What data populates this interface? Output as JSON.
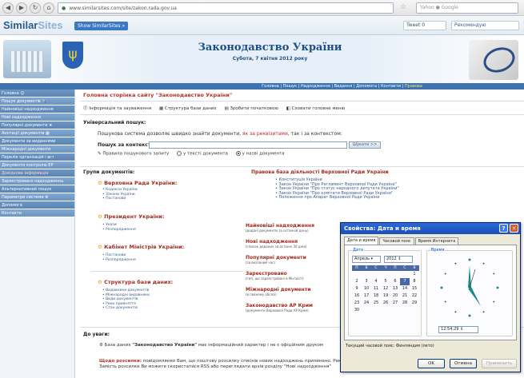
{
  "browser": {
    "url": "www.similarsites.com/site/zakon.rada.gov.ua",
    "search_placeholder": "Yahoo ● Google"
  },
  "similarsites": {
    "logo_a": "Similar",
    "logo_b": "Sites",
    "show_button": "Show SimilarSites »",
    "tweet": "Tweet",
    "tweet_count": "0",
    "fb": "Рекомендую"
  },
  "header": {
    "title": "Законодавство України",
    "subtitle": "Субота, 7 квітня 2012 року"
  },
  "topmenu": {
    "items": [
      "Головна",
      "Пошук",
      "Надходження",
      "Видання",
      "Допомога",
      "Контакти"
    ],
    "highlight": "Правова"
  },
  "sidebar": {
    "items": [
      "Головна ☺",
      "Пошук документів 🔍",
      "Найновіші надходження",
      "Нові надходження",
      "Популярні документи ★",
      "Анотації документів ▦",
      "Документи за виданнями",
      "Міжнародні документи",
      "Перелік організацій і вст",
      "Документи контролю ЕР",
      "Довідкова інформація",
      "Зареєстровано надходженнь",
      "Альтернативний пошук",
      "Параметри системи ⚙",
      "Допомога",
      "Контакти"
    ]
  },
  "main": {
    "title": "Головна сторінка сайту \"Законодавство України\"",
    "toolbar": [
      "⓵ Інформація та зауваження",
      "▦ Структура бази даних",
      "▤ Зробити початковою",
      "◧ Сховати головне меню"
    ],
    "search_heading": "Універсальний пошук:",
    "search_desc": "Пошукова система дозволяє швидко знайти документи,",
    "search_desc_link": "як за реквізитами",
    "search_desc_end": ", так і за контекстом:",
    "search_label": "Пошук за контекстом:",
    "search_btn": "Шукати >>",
    "opt_rules": "✎ Правила пошукового запиту",
    "opt1": "у тексті документа",
    "opt2": "у назві документа",
    "groups_title": "Групи документів:",
    "g1": "Верховна Рада України:",
    "g1_items": [
      "• Кодекси України",
      "• Закони України",
      "• Постанови"
    ],
    "g2": "Президент України:",
    "g2_items": [
      "• Укази",
      "• Розпорядження"
    ],
    "g3": "Кабінет Міністрів України:",
    "g3_items": [
      "• Постанови",
      "• Розпорядження"
    ],
    "g4": "Структура бази даних:",
    "g4_items": [
      "• Видавники документів",
      "• Міжнародні видавники",
      "• Види документів",
      "• Роки прийняття",
      "• Стан документів"
    ],
    "right_title": "Правова база діяльності Верховної Ради України",
    "right_items": [
      "• Конституція України",
      "• Закон України \"Про Регламент Верховної Ради України\"",
      "• Закон України \"Про статус народного депутата України\"",
      "• Закон України \"Про комітети Верховної Ради України\"",
      "• Положення про Апарат Верховної Ради України"
    ],
    "rs1_h": "Найновіші надходження",
    "rs1_s": "(додані документи за останній день)",
    "rs2_h": "Нові надходження",
    "rs2_s": "(список доданих за останні 30 днів)",
    "rs3_h": "Популярні документи",
    "rs3_s": "(за вказаний час)",
    "rs4_h": "Зареєстровано",
    "rs4_s": "(тип, що зареєстровані в Мін'юсті)",
    "rs5_h": "Міжнародні документи",
    "rs5_s": "(в повному обсязі)",
    "rs6_h": "Законодавство АР Крим",
    "rs6_s": "(документи Верховної Ради АР Крим)",
    "foot_title": "До уваги:",
    "foot_p1_prefix": "⚙ База даних",
    "foot_p1_bold": "\"Законодавство України\"",
    "foot_p1_rest": "має інформаційний характер і не є офіційним друком",
    "foot_p2_red": "Щодо розсилки:",
    "foot_p2_rest": "повідомляємо Вам, що поштову розсилку списків нових надходжень припинено. Рекомендуємо до впровадження нового порталу Верховної Ради України! Замість розсилки Ви можете скористатися RSS або переглядати архів розділу \"Нові надходження\""
  },
  "dialog": {
    "title": "Свойства: Дата и время",
    "tabs": [
      "Дата и время",
      "Часовой пояс",
      "Время Интернета"
    ],
    "date_label": "Дата",
    "time_label": "Время",
    "month": "Апрель",
    "year": "2012",
    "weekdays": [
      "П",
      "В",
      "С",
      "Ч",
      "П",
      "С",
      "В"
    ],
    "weeks": [
      [
        "",
        "",
        "",
        "",
        "",
        "",
        "1"
      ],
      [
        "2",
        "3",
        "4",
        "5",
        "6",
        "7",
        "8"
      ],
      [
        "9",
        "10",
        "11",
        "12",
        "13",
        "14",
        "15"
      ],
      [
        "16",
        "17",
        "18",
        "19",
        "20",
        "21",
        "22"
      ],
      [
        "23",
        "24",
        "25",
        "26",
        "27",
        "28",
        "29"
      ],
      [
        "30",
        "",
        "",
        "",
        "",
        "",
        ""
      ]
    ],
    "selected_day": "7",
    "time": "12:54:29",
    "timezone": "Текущий часовой пояс: Финляндия (лето)",
    "ok": "OK",
    "cancel": "Отмена",
    "apply": "Применить"
  },
  "colors": {
    "accent": "#3f73ad",
    "title_red": "#a02a20",
    "dialog_title": "#2c68d6"
  }
}
